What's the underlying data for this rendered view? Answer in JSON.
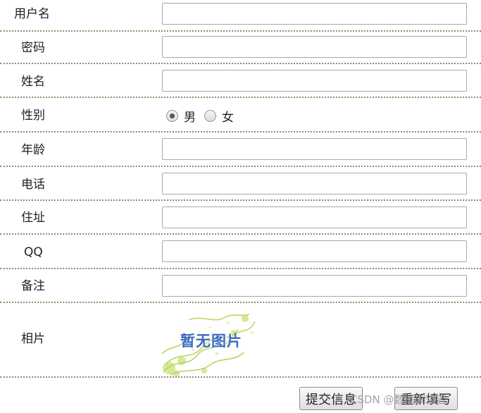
{
  "form": {
    "username": {
      "label": "用户名",
      "value": ""
    },
    "password": {
      "label": "密码",
      "value": ""
    },
    "realname": {
      "label": "姓名",
      "value": ""
    },
    "gender": {
      "label": "性别",
      "options": [
        {
          "label": "男",
          "selected": true
        },
        {
          "label": "女",
          "selected": false
        }
      ]
    },
    "age": {
      "label": "年龄",
      "value": ""
    },
    "phone": {
      "label": "电话",
      "value": ""
    },
    "address": {
      "label": "住址",
      "value": ""
    },
    "qq": {
      "label": "QQ",
      "value": ""
    },
    "note": {
      "label": "备注",
      "value": ""
    },
    "photo": {
      "label": "相片",
      "placeholder_text": "暂无图片"
    }
  },
  "actions": {
    "submit_label": "提交信息",
    "reset_label": "重新填写"
  },
  "watermark": "CSDN @数据调查者",
  "colors": {
    "divider": "#8c8c6a",
    "photo_text": "#3a6bbd",
    "photo_swirl": "#a8cc3a"
  }
}
